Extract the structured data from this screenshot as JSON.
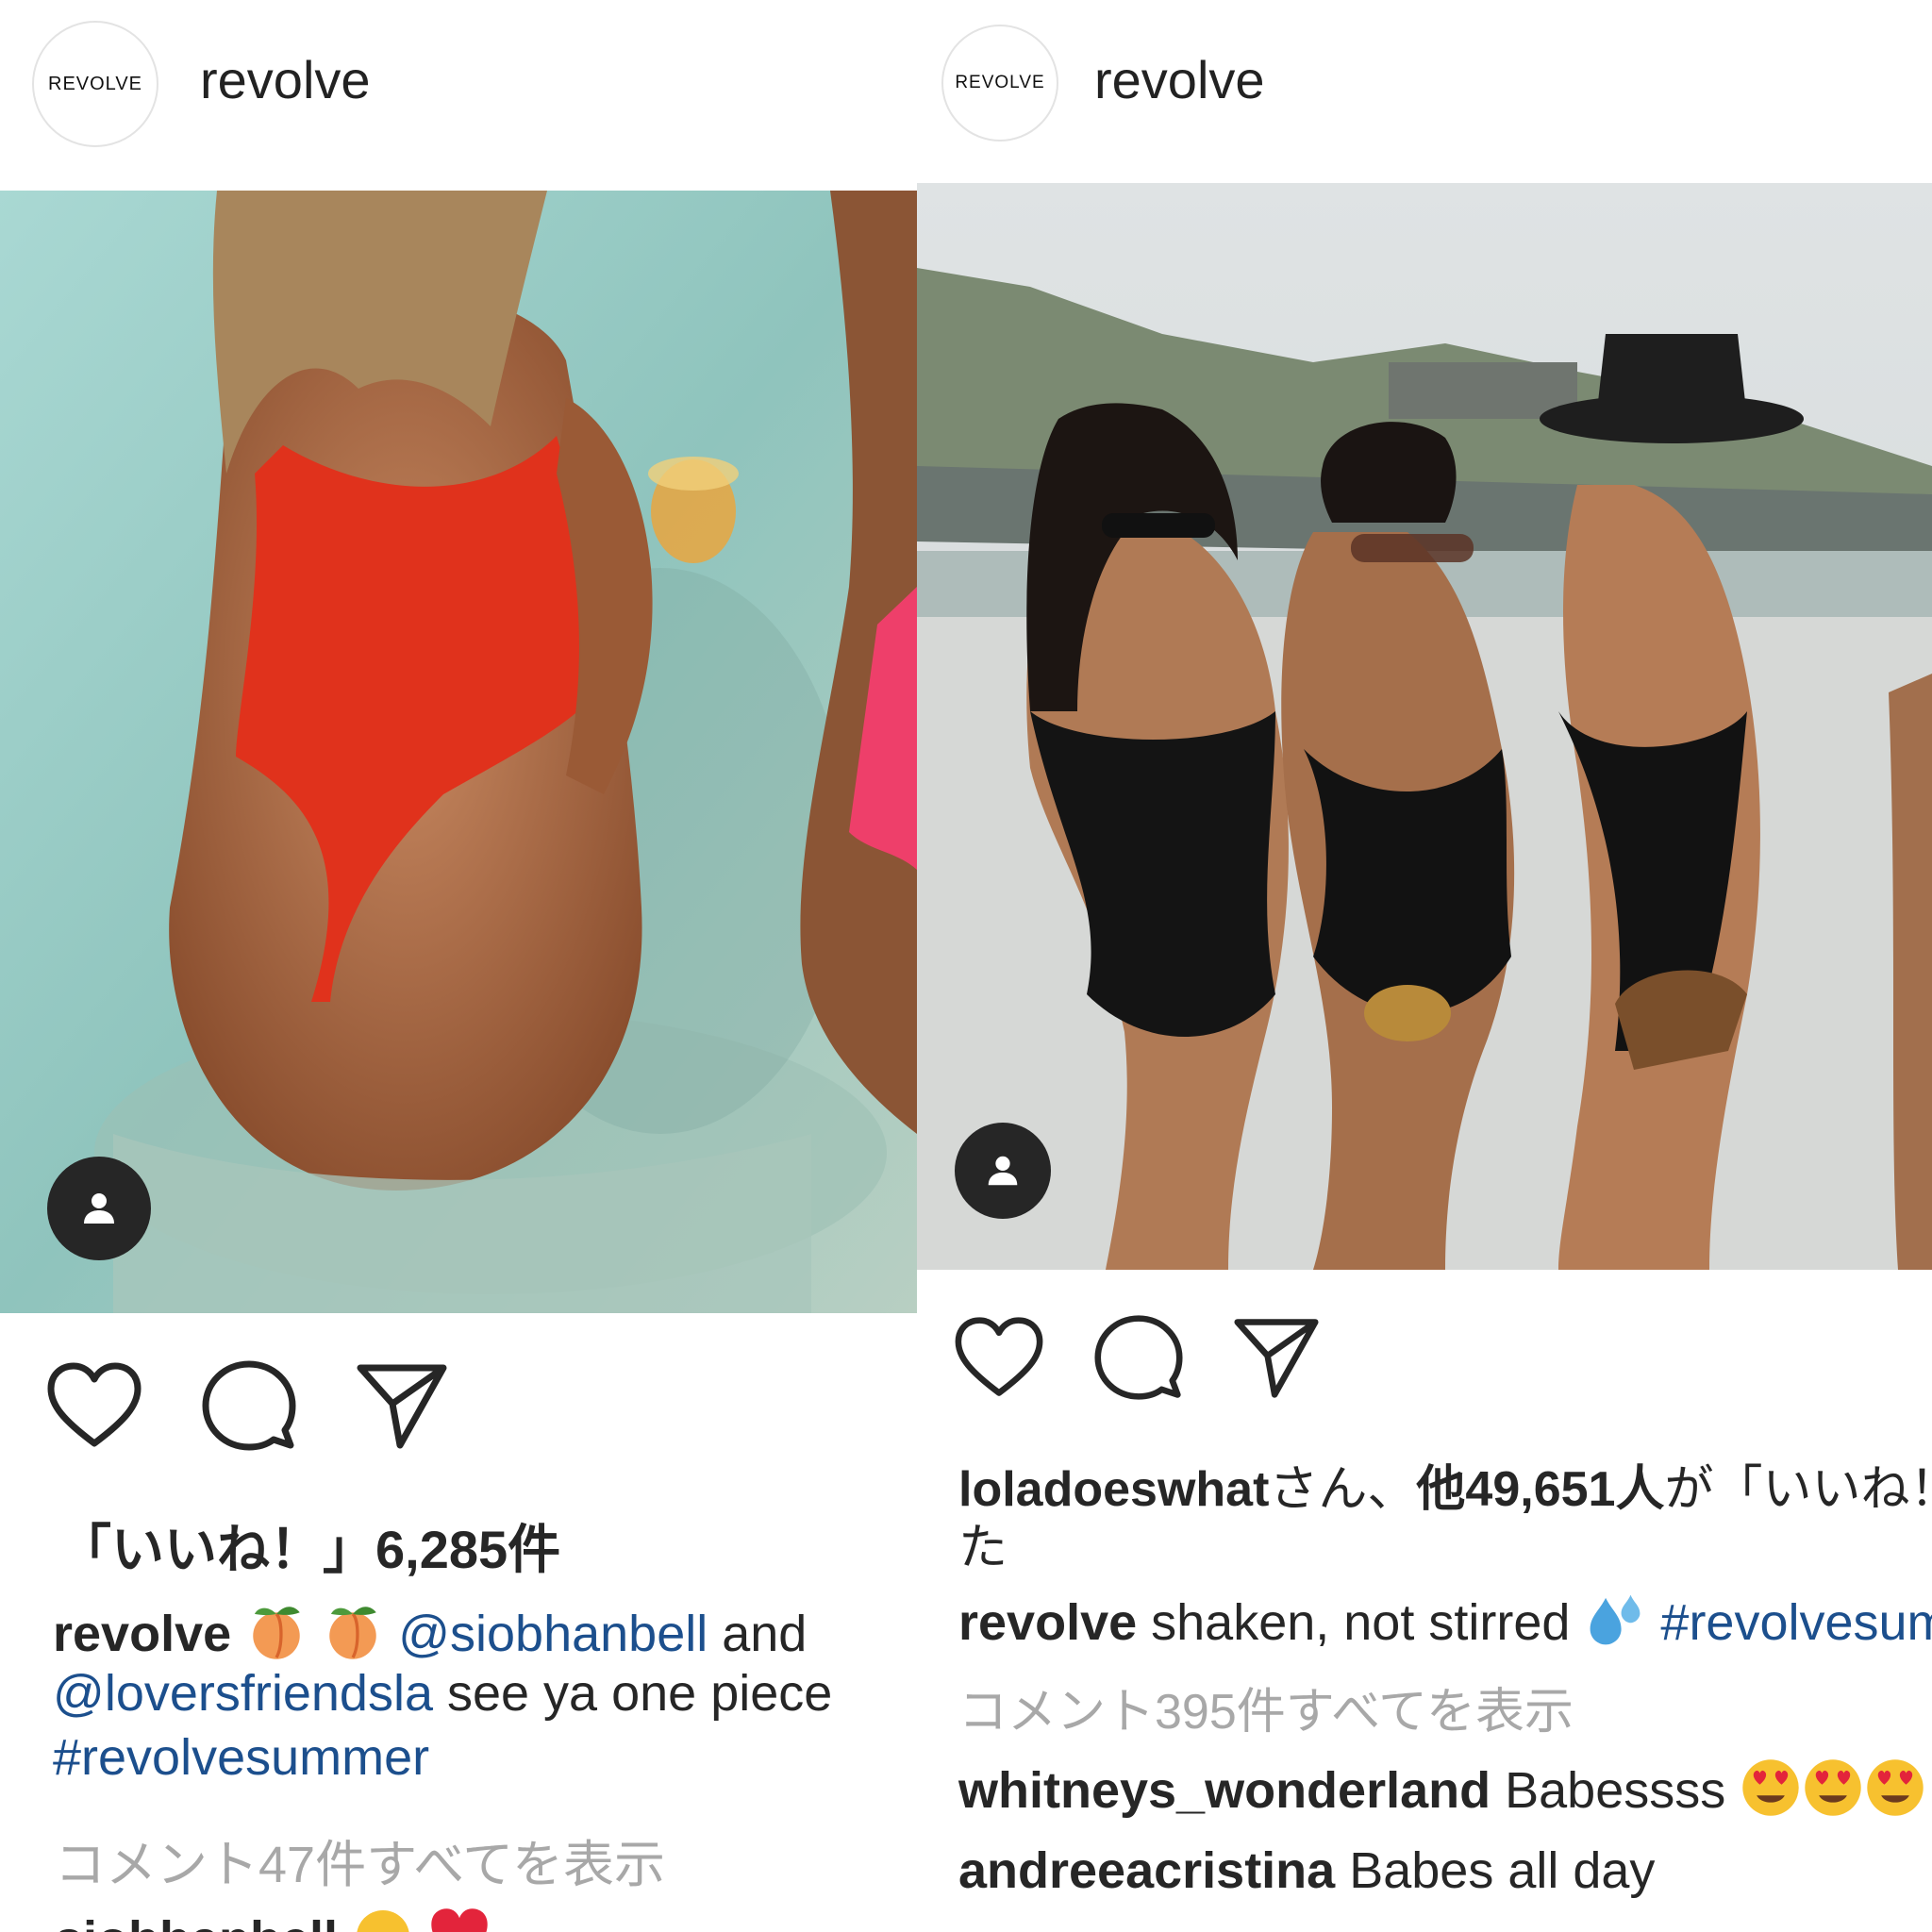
{
  "posts": [
    {
      "username": "revolve",
      "avatar_text": "REVOLVE",
      "likes_text": "「いいね！」6,285件",
      "caption": {
        "user": "revolve",
        "emojis": [
          "peach",
          "peach"
        ],
        "mention1": "@siobhanbell",
        "and_text": " and ",
        "mention2": "@loversfriendsla",
        "text": " see ya one piece",
        "hashtag": "#revolvesummer"
      },
      "view_comments": "コメント47件すべてを表示",
      "partial_comment": {
        "user": "siobhanbell",
        "emojis": [
          "grin",
          "heart"
        ]
      },
      "icons": {
        "like": "heart-outline-icon",
        "comment": "comment-bubble-icon",
        "share": "paper-plane-icon",
        "tag": "person-tag-icon"
      }
    },
    {
      "username": "revolve",
      "avatar_text": "REVOLVE",
      "likes": {
        "user": "loladoeswhat",
        "middle": "さん、",
        "count": "他49,651人",
        "rest": "が「いいね！」しました",
        "wrap": "た"
      },
      "caption": {
        "user": "revolve",
        "text": " shaken, not stirred ",
        "emoji": "sweat-droplets",
        "hashtag": "#revolvesummer"
      },
      "view_comments": "コメント395件すべてを表示",
      "comments": [
        {
          "user": "whitneys_wonderland",
          "text": " Babessss ",
          "emojis": [
            "heart-eyes",
            "heart-eyes",
            "heart-eyes"
          ]
        },
        {
          "user": "andreeacristina",
          "text": " Babes all day"
        }
      ],
      "icons": {
        "like": "heart-outline-icon",
        "comment": "comment-bubble-icon",
        "share": "paper-plane-icon",
        "tag": "person-tag-icon"
      }
    }
  ],
  "colors": {
    "link": "#1c4f8d",
    "muted": "#a8a8a8",
    "text": "#262626"
  }
}
